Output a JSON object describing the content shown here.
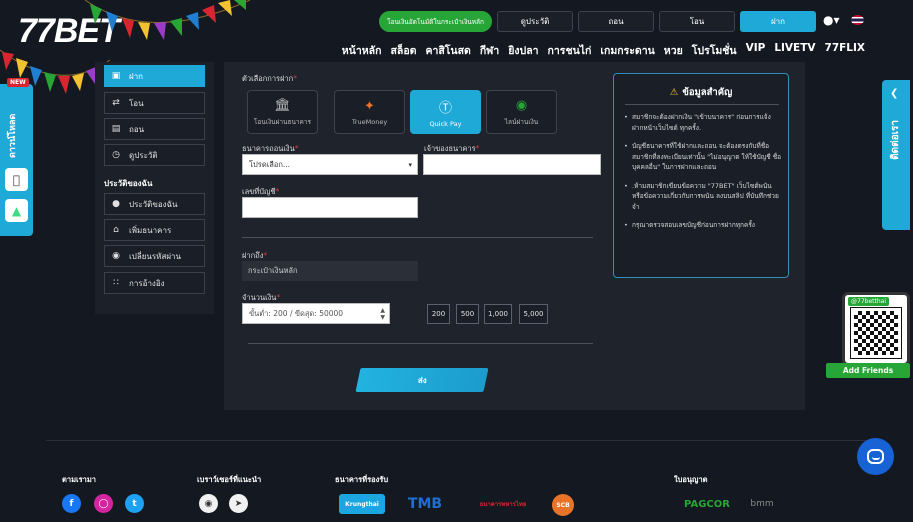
{
  "header": {
    "logo_num": "77",
    "logo_text": "BET",
    "promo_button": "โอนเงินอัตโนมัติในกระเป๋าเงินหลัก",
    "history_button": "ดูประวัติ",
    "withdraw_button": "ถอน",
    "transfer_button": "โอน",
    "deposit_button": "ฝาก",
    "user_icon": "user-icon",
    "flag": "thai-flag-icon"
  },
  "nav": [
    "หน้าหลัก",
    "สล็อต",
    "คาสิโนสด",
    "กีฬา",
    "ยิงปลา",
    "การชนไก่",
    "เกมกระดาน",
    "หวย",
    "โปรโมชั่น",
    "VIP",
    "LIVETV",
    "77FLIX"
  ],
  "download_bar": {
    "badge": "NEW",
    "label": "ดาวน์โหลด"
  },
  "contact_bar": {
    "label": "ติดต่อเรา"
  },
  "line_card": {
    "handle": "@77betthai",
    "add_label": "Add Friends"
  },
  "sidebar": {
    "items": [
      {
        "label": "ฝาก",
        "icon": "wallet-icon"
      },
      {
        "label": "โอน",
        "icon": "transfer-icon"
      },
      {
        "label": "ถอน",
        "icon": "atm-icon"
      },
      {
        "label": "ดูประวัติ",
        "icon": "history-icon"
      }
    ],
    "heading": "ประวัติของฉัน",
    "profile_items": [
      {
        "label": "ประวัติของฉัน",
        "icon": "person-icon"
      },
      {
        "label": "เพิ่มธนาคาร",
        "icon": "bank-icon"
      },
      {
        "label": "เปลี่ยนรหัสผ่าน",
        "icon": "lock-icon"
      },
      {
        "label": "การอ้างอิง",
        "icon": "referral-icon"
      }
    ]
  },
  "form": {
    "method_label": "ตัวเลือกการฝาก",
    "methods": [
      {
        "label": "โอนเงินผ่านธนาคาร",
        "icon": "bank-building-icon"
      },
      {
        "label": "TrueMoney",
        "icon": "truemoney-icon"
      },
      {
        "label": "Quick Pay",
        "icon": "dollar-coin-icon"
      },
      {
        "label": "ไลน์ผ่านเงิน",
        "icon": "line-icon"
      }
    ],
    "active_method": 2,
    "bank_label": "ธนาคารถอนเงิน",
    "bank_placeholder": "โปรดเลือก...",
    "owner_label": "เจ้าของธนาคาร",
    "account_label": "เลขที่บัญชี",
    "deposit_to_label": "ฝากถึง",
    "deposit_to_value": "กระเป๋าเงินหลัก",
    "amount_label": "จำนวนเงิน",
    "amount_placeholder": "ขั้นต่ำ: 200 / ขีดสุด: 50000",
    "quick_amounts": [
      "200",
      "500",
      "1,000",
      "5,000"
    ],
    "submit": "ส่ง"
  },
  "notice": {
    "title": "ข้อมูลสำคัญ",
    "items": [
      "สมาชิกจะต้องฝากเงิน \"เข้าบนาคาร\" ก่อนการแจ้งฝากหน้าเว็บไซต์ ทุกครั้ง.",
      "บัญชีธนาคารที่ใช้ฝากและถอน จะต้องตรงกับที่ชื่อสมาชิกที่ลงทะเบียนเท่านั้น \"ไม่อนุญาต ให้ใช้บัญชี ชื่อบุคคลอื่น\" ในการฝากและถอน",
      ".ห้ามสมาชิกเขียนข้อความ \"77BET\" เว็บไซต์พนันหรือข้อความเกี่ยวกับการพนัน ลงบนสลิป ที่บันทึกช่วยจำ",
      "กรุณาตรวจสอบเลขบัญชีก่อนการฝากทุกครั้ง"
    ]
  },
  "footer": {
    "follow_heading": "ตามเรามา",
    "browser_heading": "เบราว์เซอร์ที่แนะนำ",
    "banks_heading": "ธนาคารที่รองรับ",
    "license_heading": "ใบอนุญาต",
    "banks": [
      "Krungthai",
      "TMB",
      "ธนาคารทหารไทย",
      "SCB"
    ],
    "licenses": [
      "PAGCOR",
      "bmm"
    ]
  },
  "colors": {
    "accent": "#1ea9d6",
    "bg": "#141820",
    "panel": "#1f242c",
    "green": "#27a637"
  }
}
